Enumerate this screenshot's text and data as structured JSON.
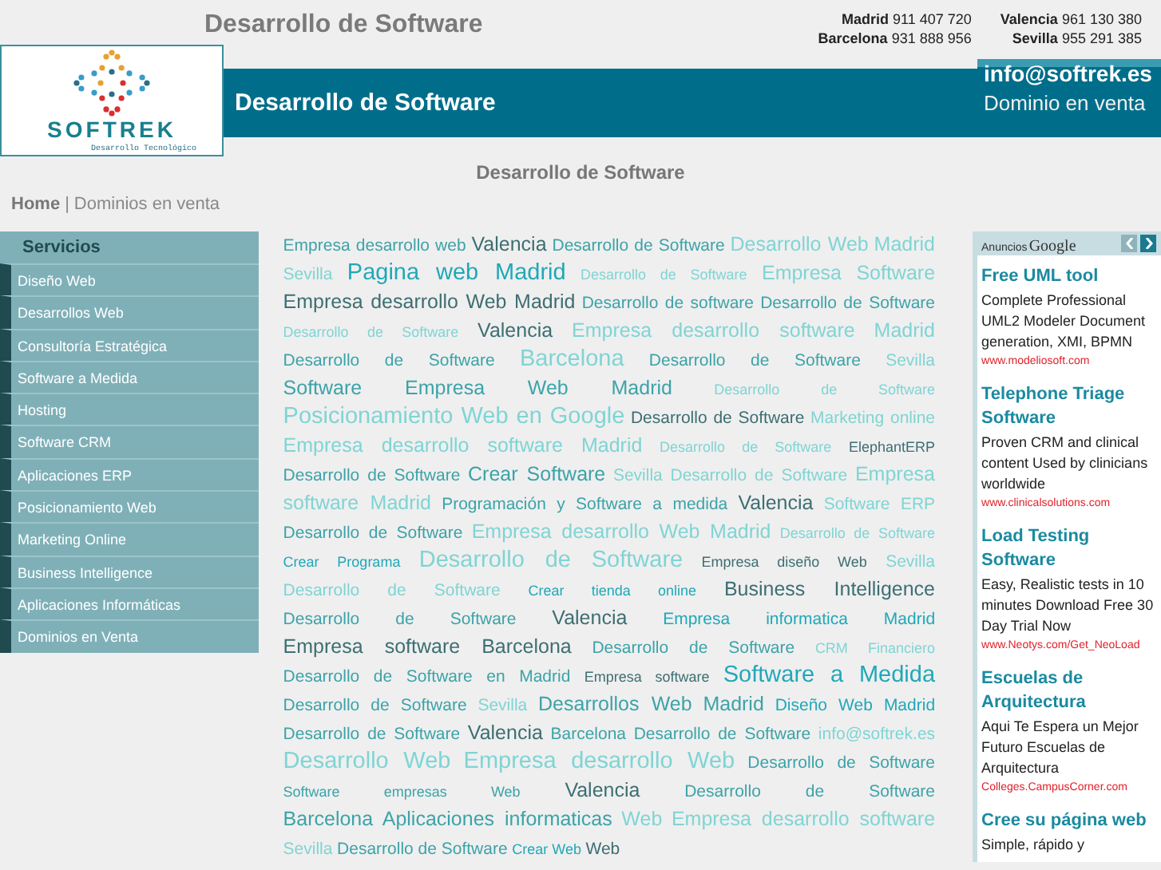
{
  "header": {
    "title": "Desarrollo de Software",
    "phones": [
      {
        "city": "Madrid",
        "number": "911 407 720"
      },
      {
        "city": "Valencia",
        "number": "961 130 380"
      },
      {
        "city": "Barcelona",
        "number": "931 888 956"
      },
      {
        "city": "Sevilla",
        "number": "955 291 385"
      }
    ]
  },
  "logo": {
    "name": "SOFTREK",
    "tagline": "Desarrollo Tecnológico"
  },
  "band": {
    "title": "Desarrollo de Software",
    "email": "info@softrek.es",
    "note": "Dominio en venta"
  },
  "subtitle": "Desarrollo de Software",
  "breadcrumb": {
    "home": "Home",
    "separator": "|",
    "current": "Dominios en venta"
  },
  "sidebar": {
    "title": "Servicios",
    "items": [
      "Diseño Web",
      "Desarrollos Web",
      "Consultoría Estratégica",
      "Software a Medida",
      "Hosting",
      "Software CRM",
      "Aplicaciones ERP",
      "Posicionamiento Web",
      "Marketing Online",
      "Business Intelligence",
      "Aplicaciones Informáticas",
      "Dominios en Venta"
    ]
  },
  "tags": [
    {
      "text": "Empresa desarrollo web",
      "kind": "normal",
      "color": "#3ca3a8"
    },
    {
      "text": "Valencia",
      "kind": "major",
      "color": "#3d6e72"
    },
    {
      "text": "Desarrollo de Software",
      "kind": "normal",
      "color": "#3ca3a8"
    },
    {
      "text": "Desarrollo Web",
      "kind": "major",
      "color": "#80d4d4"
    },
    {
      "text": "Madrid",
      "kind": "major",
      "color": "#80d4d4"
    },
    {
      "text": "Sevilla",
      "kind": "normal",
      "color": "#80d4d4"
    },
    {
      "text": "Pagina web Madrid",
      "kind": "top",
      "color": "#20a8b8"
    },
    {
      "text": "Desarrollo de Software",
      "kind": "minor",
      "color": "#80d4d4"
    },
    {
      "text": "Empresa",
      "kind": "major",
      "color": "#80d4d4"
    },
    {
      "text": "Software",
      "kind": "major",
      "color": "#80d4d4"
    },
    {
      "text": "Empresa desarrollo Web Madrid",
      "kind": "major",
      "color": "#3d6e72"
    },
    {
      "text": "Desarrollo de software",
      "kind": "normal",
      "color": "#3ca3a8"
    },
    {
      "text": "Desarrollo de Software",
      "kind": "normal",
      "color": "#3ca3a8"
    },
    {
      "text": "Desarrollo de Software",
      "kind": "minor",
      "color": "#80d4d4"
    },
    {
      "text": "Valencia",
      "kind": "major",
      "color": "#3d6e72"
    },
    {
      "text": "Empresa desarrollo software",
      "kind": "major",
      "color": "#80d4d4"
    },
    {
      "text": "Madrid",
      "kind": "major",
      "color": "#80d4d4"
    },
    {
      "text": "Desarrollo de Software",
      "kind": "normal",
      "color": "#3ca3a8"
    },
    {
      "text": "Barcelona",
      "kind": "top",
      "color": "#80d4d4"
    },
    {
      "text": "Desarrollo de Software",
      "kind": "normal",
      "color": "#3ca3a8"
    },
    {
      "text": "Sevilla",
      "kind": "normal",
      "color": "#80d4d4"
    },
    {
      "text": "Software Empresa Web Madrid",
      "kind": "major",
      "color": "#3ca3a8"
    },
    {
      "text": "Desarrollo de Software",
      "kind": "minor",
      "color": "#80d4d4"
    },
    {
      "text": "Posicionamiento Web en Google",
      "kind": "top",
      "color": "#80d4d4"
    },
    {
      "text": "Desarrollo de Software",
      "kind": "normal",
      "color": "#3d6e72"
    },
    {
      "text": "Marketing online",
      "kind": "normal",
      "color": "#80d4d4"
    },
    {
      "text": "Empresa desarrollo software Madrid",
      "kind": "major",
      "color": "#80d4d4"
    },
    {
      "text": "Desarrollo de Software",
      "kind": "minor",
      "color": "#80d4d4"
    },
    {
      "text": "ElephantERP",
      "kind": "minor",
      "color": "#3d6e72"
    },
    {
      "text": "Desarrollo de Software",
      "kind": "normal",
      "color": "#3ca3a8"
    },
    {
      "text": "Crear Software",
      "kind": "major",
      "color": "#3ca3a8"
    },
    {
      "text": "Sevilla",
      "kind": "normal",
      "color": "#80d4d4"
    },
    {
      "text": "Desarrollo de Software",
      "kind": "normal",
      "color": "#80d4d4"
    },
    {
      "text": "Empresa",
      "kind": "major",
      "color": "#80d4d4"
    },
    {
      "text": "software Madrid",
      "kind": "major",
      "color": "#80d4d4"
    },
    {
      "text": "Programación y Software a medida",
      "kind": "normal",
      "color": "#3ca3a8"
    },
    {
      "text": "Valencia",
      "kind": "major",
      "color": "#3d6e72"
    },
    {
      "text": "Software ERP",
      "kind": "normal",
      "color": "#80d4d4"
    },
    {
      "text": "Desarrollo de Software",
      "kind": "normal",
      "color": "#3ca3a8"
    },
    {
      "text": "Empresa desarrollo Web Madrid",
      "kind": "major",
      "color": "#80d4d4"
    },
    {
      "text": "Desarrollo de Software",
      "kind": "minor",
      "color": "#80d4d4"
    },
    {
      "text": "Crear Programa",
      "kind": "minor",
      "color": "#20a8b8"
    },
    {
      "text": "Desarrollo de Software",
      "kind": "top",
      "color": "#80d4d4"
    },
    {
      "text": "Empresa diseño Web",
      "kind": "minor",
      "color": "#3d6e72"
    },
    {
      "text": "Sevilla",
      "kind": "normal",
      "color": "#80d4d4"
    },
    {
      "text": "Desarrollo de Software",
      "kind": "normal",
      "color": "#80d4d4"
    },
    {
      "text": "Crear tienda online",
      "kind": "minor",
      "color": "#20a8b8"
    },
    {
      "text": "Business Intelligence",
      "kind": "major",
      "color": "#3d6e72"
    },
    {
      "text": "Desarrollo de Software",
      "kind": "normal",
      "color": "#3ca3a8"
    },
    {
      "text": "Valencia",
      "kind": "major",
      "color": "#3d6e72"
    },
    {
      "text": "Empresa informatica Madrid",
      "kind": "normal",
      "color": "#20a8b8"
    },
    {
      "text": "Empresa software Barcelona",
      "kind": "major",
      "color": "#3d6e72"
    },
    {
      "text": "Desarrollo de Software",
      "kind": "normal",
      "color": "#3ca3a8"
    },
    {
      "text": "CRM Financiero",
      "kind": "minor",
      "color": "#80d4d4"
    },
    {
      "text": "Desarrollo de Software en Madrid",
      "kind": "normal",
      "color": "#3ca3a8"
    },
    {
      "text": "Empresa software",
      "kind": "minor",
      "color": "#3d6e72"
    },
    {
      "text": "Software a Medida",
      "kind": "top",
      "color": "#20a8b8"
    },
    {
      "text": "Desarrollo de Software",
      "kind": "normal",
      "color": "#3ca3a8"
    },
    {
      "text": "Sevilla",
      "kind": "normal",
      "color": "#80d4d4"
    },
    {
      "text": "Desarrollos Web",
      "kind": "major",
      "color": "#3ca3a8"
    },
    {
      "text": "Madrid",
      "kind": "major",
      "color": "#3ca3a8"
    },
    {
      "text": "Diseño Web Madrid",
      "kind": "normal",
      "color": "#20a8b8"
    },
    {
      "text": "Desarrollo de Software",
      "kind": "normal",
      "color": "#3ca3a8"
    },
    {
      "text": "Valencia",
      "kind": "major",
      "color": "#3d6e72"
    },
    {
      "text": "Barcelona",
      "kind": "normal",
      "color": "#3ca3a8"
    },
    {
      "text": "Desarrollo de Software",
      "kind": "normal",
      "color": "#3ca3a8"
    },
    {
      "text": "info@softrek.es",
      "kind": "normal",
      "color": "#80d4d4"
    },
    {
      "text": "Desarrollo Web",
      "kind": "top",
      "color": "#80d4d4"
    },
    {
      "text": "Empresa desarrollo Web",
      "kind": "top",
      "color": "#80d4d4"
    },
    {
      "text": "Desarrollo de Software",
      "kind": "normal",
      "color": "#3ca3a8"
    },
    {
      "text": "Software empresas Web",
      "kind": "minor",
      "color": "#3ca3a8"
    },
    {
      "text": "Valencia",
      "kind": "major",
      "color": "#3d6e72"
    },
    {
      "text": "Desarrollo de Software",
      "kind": "normal",
      "color": "#3ca3a8"
    },
    {
      "text": "Barcelona Aplicaciones informaticas",
      "kind": "major",
      "color": "#3ca3a8"
    },
    {
      "text": "Web",
      "kind": "major",
      "color": "#80d4d4"
    },
    {
      "text": "Empresa desarrollo software",
      "kind": "major",
      "color": "#80d4d4"
    },
    {
      "text": "Sevilla",
      "kind": "normal",
      "color": "#80d4d4"
    },
    {
      "text": "Desarrollo de Software",
      "kind": "normal",
      "color": "#3ca3a8"
    },
    {
      "text": "Crear Web",
      "kind": "minor",
      "color": "#20a8b8"
    },
    {
      "text": "Web",
      "kind": "normal",
      "color": "#3d6e72"
    }
  ],
  "ads": {
    "label": "Anuncios",
    "brand": "Google",
    "items": [
      {
        "title": "Free UML tool",
        "text": "Complete Professional UML2 Modeler Document generation, XMI, BPMN",
        "url": "www.modeliosoft.com"
      },
      {
        "title": "Telephone Triage Software",
        "text": "Proven CRM and clinical content Used by clinicians worldwide",
        "url": "www.clinicalsolutions.com"
      },
      {
        "title": "Load Testing Software",
        "text": "Easy, Realistic tests in 10 minutes Download Free 30 Day Trial Now",
        "url": "www.Neotys.com/Get_NeoLoad"
      },
      {
        "title": "Escuelas de Arquitectura",
        "text": "Aqui Te Espera un Mejor Futuro Escuelas de Arquitectura",
        "url": "Colleges.CampusCorner.com"
      },
      {
        "title": "Cree su página web",
        "text": "Simple, rápido y"
      }
    ]
  }
}
